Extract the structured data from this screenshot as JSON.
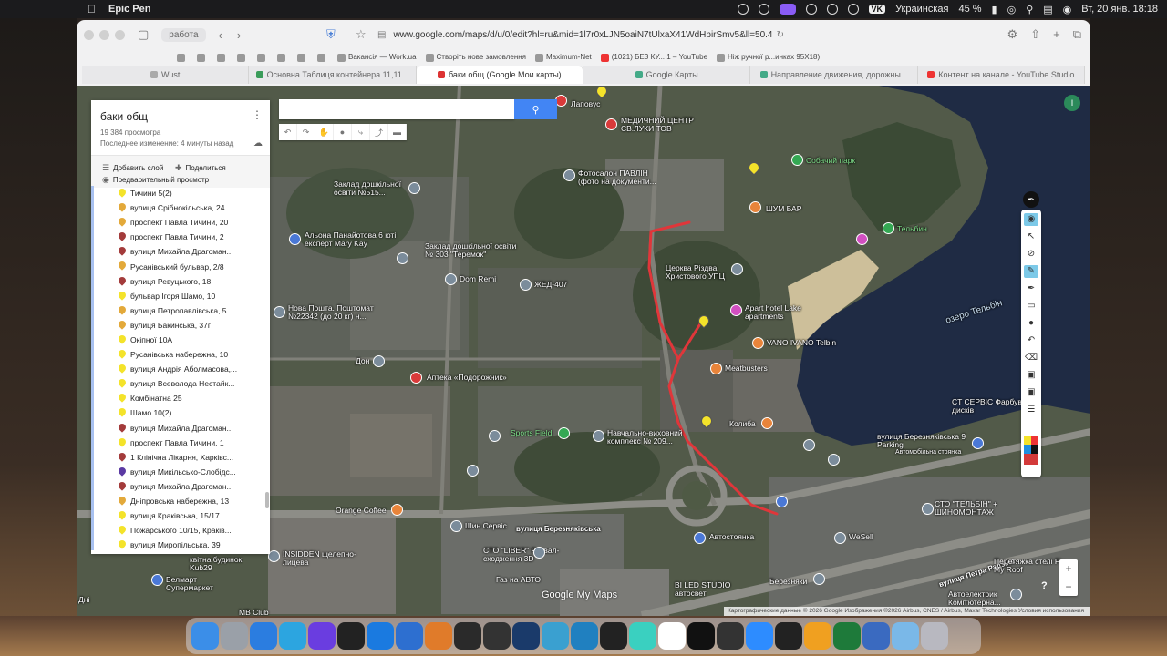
{
  "menubar": {
    "app_name": "Epic Pen",
    "keyboard_badge": "VK",
    "language": "Украинская",
    "battery": "45 %",
    "datetime": "Вт, 20 янв.  18:18"
  },
  "browser": {
    "profile": "работа",
    "url": "www.google.com/maps/d/u/0/edit?hl=ru&mid=1l7r0xLJN5oaiN7tUlxaX41WdHpirSmv5&ll=50.4240",
    "bookmarks": [
      "Вакансія — Work.ua",
      "Створіть нове замовлення",
      "Maximum-Net",
      "(1021) БЕЗ КУ... 1 – YouTube",
      "Ніж ручної р...инках 95X18)"
    ],
    "tabs": [
      {
        "label": "Wust",
        "active": false
      },
      {
        "label": "Основна Таблиця контейнера 11,11...",
        "active": false
      },
      {
        "label": "баки общ (Google Мои карты)",
        "active": true
      },
      {
        "label": "Google Карты",
        "active": false
      },
      {
        "label": "Направление движения, дорожны...",
        "active": false
      },
      {
        "label": "Контент на канале - YouTube Studio",
        "active": false
      }
    ]
  },
  "panel": {
    "title": "баки общ",
    "views": "19 384 просмотра",
    "modified": "Последнее изменение: 4 минуты назад",
    "add_layer": "Добавить слой",
    "share": "Поделиться",
    "preview": "Предварительный просмотр",
    "items": [
      {
        "label": "Тичини 5(2)",
        "color": "#f4e32a"
      },
      {
        "label": "вулиця Срібнокільська, 24",
        "color": "#e3a93a"
      },
      {
        "label": "проспект Павла Тичини, 20",
        "color": "#e3a93a"
      },
      {
        "label": "проспект Павла Тичини, 2",
        "color": "#a33b3b"
      },
      {
        "label": "вулиця Михайла Драгоман...",
        "color": "#a33b3b"
      },
      {
        "label": "Русанівський бульвар, 2/8",
        "color": "#e3a93a"
      },
      {
        "label": "вулиця Ревуцького, 18",
        "color": "#a33b3b"
      },
      {
        "label": "бульвар Ігоря Шамо, 10",
        "color": "#f4e32a"
      },
      {
        "label": "вулиця Петропавлівська, 5...",
        "color": "#e3a93a"
      },
      {
        "label": "вулиця Бакинська, 37г",
        "color": "#e3a93a"
      },
      {
        "label": "Окіпної 10А",
        "color": "#f4e32a"
      },
      {
        "label": "Русанівська набережна, 10",
        "color": "#f4e32a"
      },
      {
        "label": "вулиця Андрія Аболмасова,...",
        "color": "#f4e32a"
      },
      {
        "label": "вулиця Всеволода Нестайк...",
        "color": "#f4e32a"
      },
      {
        "label": "Комбінатна 25",
        "color": "#f4e32a"
      },
      {
        "label": "Шамо 10(2)",
        "color": "#f4e32a"
      },
      {
        "label": "вулиця Михайла Драгоман...",
        "color": "#a33b3b"
      },
      {
        "label": "проспект Павла Тичини, 1",
        "color": "#f4e32a"
      },
      {
        "label": "1 Клінічна Лікарня, Харківс...",
        "color": "#a33b3b"
      },
      {
        "label": "вулиця Микільсько-Слобідс...",
        "color": "#5b3aa3"
      },
      {
        "label": "вулиця Михайла Драгоман...",
        "color": "#a33b3b"
      },
      {
        "label": "Дніпровська набережна, 13",
        "color": "#e3a93a"
      },
      {
        "label": "вулиця Краківська, 15/17",
        "color": "#f4e32a"
      },
      {
        "label": "Пожарського 10/15, Краків...",
        "color": "#f4e32a"
      },
      {
        "label": "вулиця Миропільська, 39",
        "color": "#f4e32a"
      }
    ]
  },
  "map": {
    "search_placeholder": "",
    "avatar_letter": "I",
    "attribution": "Картографические данные © 2026 Google Изображения ©2026 Airbus, CNES / Airbus, Maxar Technologies    Условия использования",
    "logo": "Google My Maps",
    "help": "?",
    "labels": [
      {
        "text": "Лаповус",
        "cls": ""
      },
      {
        "text": "МЕДИЧНИЙ ЦЕНТР СВ.ЛУКИ ТОВ",
        "cls": ""
      },
      {
        "text": "Собачий парк",
        "cls": "green"
      },
      {
        "text": "Фотосалон ПАВЛІН (фото на документи...",
        "cls": ""
      },
      {
        "text": "Заклад дошкільної освіти №515...",
        "cls": ""
      },
      {
        "text": "ШУМ БАР",
        "cls": ""
      },
      {
        "text": "Тельбин",
        "cls": "green"
      },
      {
        "text": "Альона Панайотова 6 юті експерт Mary Kay",
        "cls": ""
      },
      {
        "text": "Заклад дошкільної освіти № 303 \"Теремок\"",
        "cls": ""
      },
      {
        "text": "Церква Різдва Христового УПЦ",
        "cls": ""
      },
      {
        "text": "Dom Remi",
        "cls": ""
      },
      {
        "text": "ЖЕД-407",
        "cls": ""
      },
      {
        "text": "Нова Пошта. Поштомат №22342 (до 20 кг) н...",
        "cls": ""
      },
      {
        "text": "Apart hotel Lake apartments",
        "cls": ""
      },
      {
        "text": "озеро Тельбін",
        "cls": "water"
      },
      {
        "text": "VANO IVANO Telbin",
        "cls": ""
      },
      {
        "text": "Дон",
        "cls": ""
      },
      {
        "text": "Meatbusters",
        "cls": ""
      },
      {
        "text": "Аптека «Подорожник»",
        "cls": ""
      },
      {
        "text": "CT СЕРВІС Фарбування дисків",
        "cls": ""
      },
      {
        "text": "Колиба",
        "cls": ""
      },
      {
        "text": "Sports Field",
        "cls": "green"
      },
      {
        "text": "Навчально-виховний комплекс № 209...",
        "cls": ""
      },
      {
        "text": "вулиця Березняківська 9 Parking",
        "cls": ""
      },
      {
        "text": "Автомобільна стоянка",
        "cls": ""
      },
      {
        "text": "Orange Coffee",
        "cls": ""
      },
      {
        "text": "Шин Сервіс",
        "cls": ""
      },
      {
        "text": "вулиця Березняківська",
        "cls": "road"
      },
      {
        "text": "Автостоянка",
        "cls": ""
      },
      {
        "text": "WeSell",
        "cls": ""
      },
      {
        "text": "СТО \"ТЕЛЬБІН\" + ШИНОМОНТАЖ",
        "cls": ""
      },
      {
        "text": "вулиця Петра Радзіна",
        "cls": "road"
      },
      {
        "text": "СТО \"LIBER\" Розвал-сходження 3D",
        "cls": ""
      },
      {
        "text": "INSIDDEN щелепно-лицева",
        "cls": ""
      },
      {
        "text": "Велмарт Супермаркет",
        "cls": ""
      },
      {
        "text": "Газ на АВТО",
        "cls": ""
      },
      {
        "text": "BI LED STUDIO автосвет",
        "cls": ""
      },
      {
        "text": "Березняки",
        "cls": ""
      },
      {
        "text": "Перетяжка стелі Fix My Roof",
        "cls": ""
      },
      {
        "text": "Автоелектрик Комп'ютерна...",
        "cls": ""
      },
      {
        "text": "квітна будинок Kub29",
        "cls": ""
      },
      {
        "text": "MB Club",
        "cls": ""
      },
      {
        "text": "Дні",
        "cls": ""
      }
    ]
  },
  "icons": {
    "search": "search-icon",
    "more": "more-vert-icon",
    "cloud": "cloud-icon"
  },
  "colors": {
    "route": "#e0363a",
    "search_button": "#4285f4",
    "list_border": "#a8c1f0"
  },
  "dock": [
    "Finder",
    "Launchpad",
    "Safari",
    "Telegram",
    "Epic Pen",
    "Notion",
    "Tasks",
    "Trello",
    "App",
    "Final Cut",
    "DaVinci",
    "Photoshop",
    "App",
    "App",
    "Activity",
    "App",
    "App",
    "ChatGPT",
    "App",
    "Zoom",
    "App",
    "Pencil",
    "Excel",
    "qBittorrent",
    "Folder",
    "Trash"
  ]
}
